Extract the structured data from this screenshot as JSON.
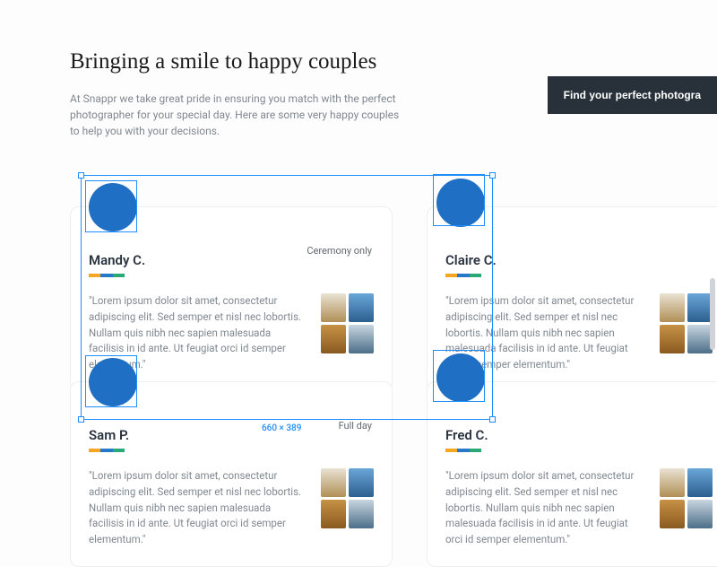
{
  "header": {
    "title": "Bringing a smile to happy couples",
    "subtitle": "At Snappr we take great pride in ensuring you match with the perfect photographer for your special day. Here are some very happy couples to help you with your decisions.",
    "cta_label": "Find your perfect photogra"
  },
  "selection": {
    "size_label": "660 × 389"
  },
  "cards": [
    {
      "name": "Mandy C.",
      "badge": "Ceremony only",
      "quote": "\"Lorem ipsum dolor sit amet, consectetur adipiscing elit. Sed semper et nisl nec lobortis. Nullam quis nibh nec sapien malesuada facilisis in id ante. Ut feugiat orci id semper elementum.\""
    },
    {
      "name": "Claire C.",
      "badge": "",
      "quote": "\"Lorem ipsum dolor sit amet, consectetur adipiscing elit. Sed semper et nisl nec lobortis. Nullam quis nibh nec sapien malesuada facilisis in id ante. Ut feugiat orci id semper elementum.\""
    },
    {
      "name": "Sam P.",
      "badge": "Full day",
      "quote": "\"Lorem ipsum dolor sit amet, consectetur adipiscing elit. Sed semper et nisl nec lobortis. Nullam quis nibh nec sapien malesuada facilisis in id ante. Ut feugiat orci id semper elementum.\""
    },
    {
      "name": "Fred C.",
      "badge": "",
      "quote": "\"Lorem ipsum dolor sit amet, consectetur adipiscing elit. Sed semper et nisl nec lobortis. Nullam quis nibh nec sapien malesuada facilisis in id ante. Ut feugiat orci id semper elementum.\""
    }
  ]
}
